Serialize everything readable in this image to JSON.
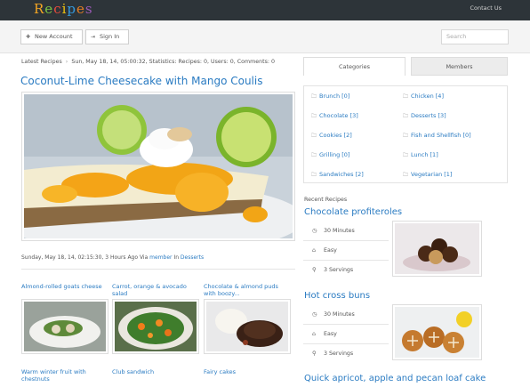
{
  "header": {
    "logo_letters": [
      "R",
      "e",
      "c",
      "i",
      "p",
      "e",
      "s"
    ],
    "logo_colors": [
      "#f5a623",
      "#7cc242",
      "#e74c3c",
      "#f1c40f",
      "#3498db",
      "#e67e22",
      "#9b59b6"
    ],
    "contact_label": "Contact Us"
  },
  "toolbar": {
    "new_account_label": "New Account",
    "signin_label": "Sign In",
    "search_placeholder": "Search"
  },
  "breadcrumb": {
    "latest_label": "Latest Recipes",
    "separator": "›",
    "stats_text": "Sun, May 18, 14, 05:00:32, Statistics: Recipes: 0, Users: 0, Comments: 0"
  },
  "featured": {
    "title": "Coconut-Lime Cheesecake with Mango Coulis",
    "meta_prefix": "Sunday, May 18, 14, 02:15:30, 3 Hours Ago Via ",
    "meta_author": "member",
    "meta_in": " In ",
    "meta_category": "Desserts"
  },
  "related": [
    {
      "title": "Almond-rolled goats cheese"
    },
    {
      "title": "Carrot, orange & avocado salad"
    },
    {
      "title": "Chocolate & almond puds with boozy..."
    }
  ],
  "related_more": [
    {
      "title": "Warm winter fruit with chestnuts"
    },
    {
      "title": "Club sandwich"
    },
    {
      "title": "Fairy cakes"
    }
  ],
  "sidebar": {
    "tabs": [
      "Categories",
      "Members"
    ],
    "categories": [
      {
        "label": "Brunch [0]"
      },
      {
        "label": "Chicken [4]"
      },
      {
        "label": "Chocolate [3]"
      },
      {
        "label": "Desserts [3]"
      },
      {
        "label": "Cookies [2]"
      },
      {
        "label": "Fish and Shellfish [0]"
      },
      {
        "label": "Grilling [0]"
      },
      {
        "label": "Lunch [1]"
      },
      {
        "label": "Sandwiches [2]"
      },
      {
        "label": "Vegetarian [1]"
      }
    ],
    "recent_label": "Recent Recipes",
    "recent": [
      {
        "title": "Chocolate profiteroles",
        "time": "30 Minutes",
        "difficulty": "Easy",
        "servings": "3 Servings"
      },
      {
        "title": "Hot cross buns",
        "time": "30 Minutes",
        "difficulty": "Easy",
        "servings": "3 Servings"
      },
      {
        "title": "Quick apricot, apple and pecan loaf cake"
      }
    ]
  },
  "icons": {
    "new_account": "user-plus-icon",
    "sign_in": "sign-in-icon",
    "folder": "folder-icon",
    "clock": "clock-icon",
    "difficulty": "gauge-icon",
    "servings": "servings-icon"
  }
}
